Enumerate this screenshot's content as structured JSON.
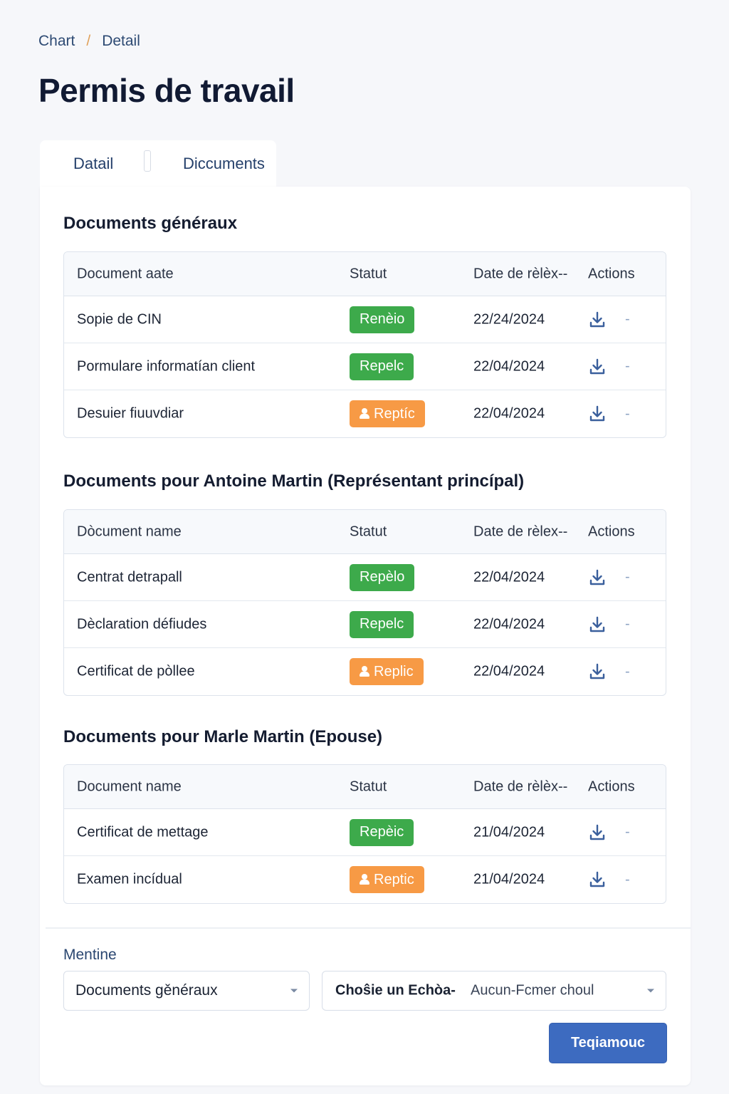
{
  "breadcrumb": {
    "root": "Chart",
    "separator": "/",
    "current": "Detail"
  },
  "page_title": "Permis de travail",
  "tabs": {
    "detail": "Datail",
    "documents": "Diccuments"
  },
  "sections": [
    {
      "title": "Documents générаux",
      "headers": {
        "name": "Document aate",
        "status": "Statut",
        "date": "Date de rèlèx--",
        "actions": "Actions"
      },
      "rows": [
        {
          "name": "Sopie de CIN",
          "status": "Renèio",
          "status_color": "green",
          "date": "22/24/2024"
        },
        {
          "name": "Pormulare informatían client",
          "status": "Repelc",
          "status_color": "green",
          "date": "22/04/2024"
        },
        {
          "name": "Desuier fiuuvdiar",
          "status": "Reptíc",
          "status_color": "orange",
          "date": "22/04/2024"
        }
      ]
    },
    {
      "title": "Documents pour Antoine Martin (Représentant princípal)",
      "headers": {
        "name": "Dòcument name",
        "status": "Statut",
        "date": "Date de rèlex--",
        "actions": "Actions"
      },
      "rows": [
        {
          "name": "Centrat detrapall",
          "status": "Repèlo",
          "status_color": "green",
          "date": "22/04/2024"
        },
        {
          "name": "Dèclaration défiudes",
          "status": "Repelc",
          "status_color": "green",
          "date": "22/04/2024"
        },
        {
          "name": "Certificat de pòllee",
          "status": "Replic",
          "status_color": "orange",
          "date": "22/04/2024"
        }
      ]
    },
    {
      "title": "Documents pour Marle Martin (Epouse)",
      "headers": {
        "name": "Document name",
        "status": "Statut",
        "date": "Date de rèlèx--",
        "actions": "Actions"
      },
      "rows": [
        {
          "name": "Certificat de mettage",
          "status": "Repèic",
          "status_color": "green",
          "date": "21/04/2024"
        },
        {
          "name": "Examen incídual",
          "status": "Reptic",
          "status_color": "orange",
          "date": "21/04/2024"
        }
      ]
    }
  ],
  "upload": {
    "label": "Mentine",
    "category_select": "Documents gěnéraux",
    "file_select_label": "Choŝie un Echòa-",
    "file_select_value": "Aucun-Fcmer choul",
    "submit": "Teqiamouc"
  },
  "colors": {
    "green": "#3daa4b",
    "orange": "#f79a45",
    "primary": "#3d6bc0"
  },
  "icons": {
    "row_action": "download-icon",
    "status_orange": "person-icon",
    "select_caret": "chevron-down-icon"
  }
}
